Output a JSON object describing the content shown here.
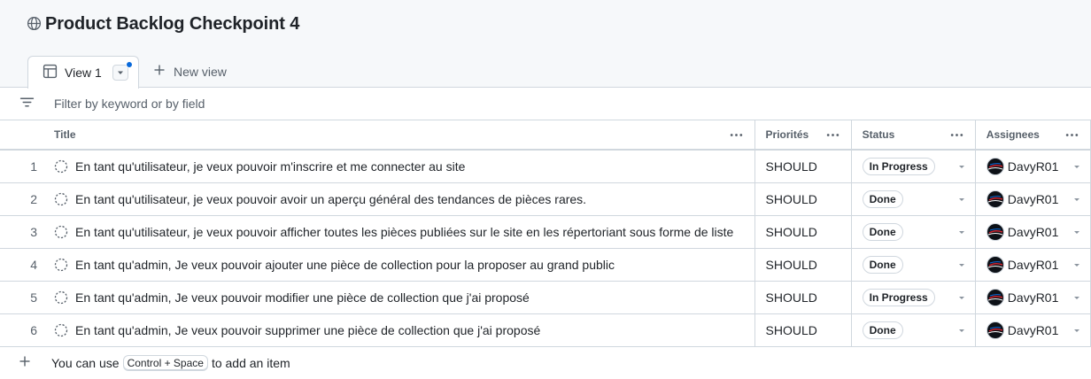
{
  "header": {
    "title": "Product Backlog Checkpoint 4"
  },
  "tabs": {
    "active_label": "View 1",
    "new_view_label": "New view"
  },
  "filter": {
    "placeholder": "Filter by keyword or by field"
  },
  "columns": {
    "title": "Title",
    "priorities": "Priorités",
    "status": "Status",
    "assignees": "Assignees"
  },
  "rows": [
    {
      "num": "1",
      "title": "En tant qu'utilisateur, je veux pouvoir m'inscrire et me connecter au site",
      "priority": "SHOULD",
      "status": "In Progress",
      "assignee": "DavyR01"
    },
    {
      "num": "2",
      "title": "En tant qu'utilisateur, je veux pouvoir avoir un aperçu général des tendances de pièces rares.",
      "priority": "SHOULD",
      "status": "Done",
      "assignee": "DavyR01"
    },
    {
      "num": "3",
      "title": "En tant qu'utilisateur, je veux pouvoir afficher toutes les pièces publiées sur le site en les répertoriant sous forme de liste",
      "priority": "SHOULD",
      "status": "Done",
      "assignee": "DavyR01"
    },
    {
      "num": "4",
      "title": "En tant qu'admin, Je veux pouvoir ajouter une pièce de collection pour la proposer au grand public",
      "priority": "SHOULD",
      "status": "Done",
      "assignee": "DavyR01"
    },
    {
      "num": "5",
      "title": "En tant qu'admin, Je veux pouvoir modifier une pièce de collection que j'ai proposé",
      "priority": "SHOULD",
      "status": "In Progress",
      "assignee": "DavyR01"
    },
    {
      "num": "6",
      "title": "En tant qu'admin, Je veux pouvoir supprimer une pièce de collection que j'ai proposé",
      "priority": "SHOULD",
      "status": "Done",
      "assignee": "DavyR01"
    }
  ],
  "add_item": {
    "prefix": "You can use",
    "shortcut": "Control + Space",
    "suffix": "to add an item"
  },
  "colors": {
    "accent": "#0969da",
    "border": "#d0d7de",
    "muted": "#57606a",
    "header_bg": "#f6f8fa"
  },
  "icons": {
    "globe": "globe-icon",
    "table": "table-icon",
    "plus": "plus-icon",
    "filter": "filter-icon",
    "kebab": "kebab-horizontal-icon",
    "draft": "draft-issue-icon",
    "caret": "triangle-down-icon"
  }
}
